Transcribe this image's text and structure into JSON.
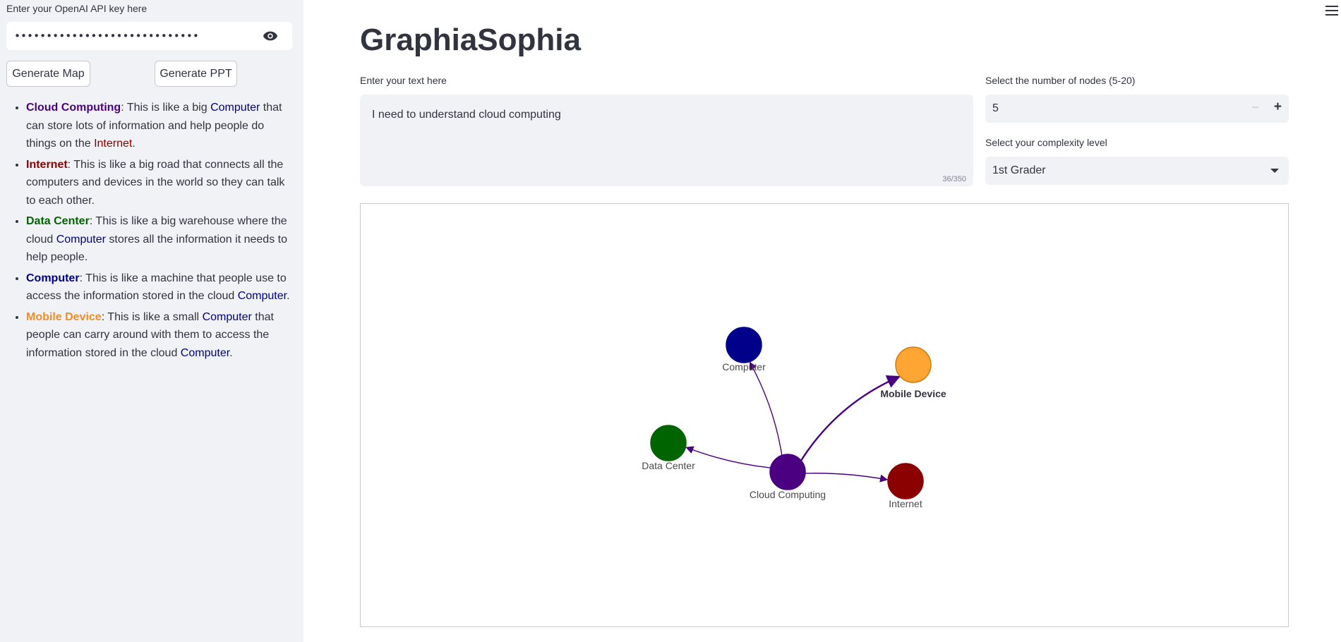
{
  "sidebar": {
    "api_label": "Enter your OpenAI API key here",
    "api_mask": "••••••••••••••••••••••••••••••••••••••••••••••••••••",
    "generate_map": "Generate Map",
    "generate_ppt": "Generate PPT",
    "definitions": [
      {
        "term": "Cloud Computing",
        "parts": [
          ": This is like a big ",
          "Computer",
          " that can store lots of information and help people do things on the ",
          "Internet",
          "."
        ]
      },
      {
        "term": "Internet",
        "text": ": This is like a big road that connects all the computers and devices in the world so they can talk to each other."
      },
      {
        "term": "Data Center",
        "parts": [
          ": This is like a big warehouse where the cloud ",
          "Computer",
          " stores all the information it needs to help people."
        ]
      },
      {
        "term": "Computer",
        "parts": [
          ": This is like a machine that people use to access the information stored in the cloud ",
          "Computer",
          "."
        ]
      },
      {
        "term": "Mobile Device",
        "parts": [
          ": This is like a small ",
          "Computer",
          " that people can carry around with them to access the information stored in the cloud ",
          "Computer",
          "."
        ]
      }
    ]
  },
  "main": {
    "title": "GraphiaSophia",
    "text_label": "Enter your text here",
    "text_value": "I need to understand cloud computing",
    "text_count": "36/350",
    "nodes_label": "Select the number of nodes (5-20)",
    "nodes_value": "5",
    "minus": "−",
    "plus": "+",
    "complexity_label": "Select your complexity level",
    "complexity_value": "1st Grader"
  },
  "graph": {
    "nodes": [
      {
        "id": "cc",
        "label": "Cloud Computing",
        "color": "#4b0082"
      },
      {
        "id": "comp",
        "label": "Computer",
        "color": "#00008b"
      },
      {
        "id": "mob",
        "label": "Mobile Device",
        "color": "#ffa533"
      },
      {
        "id": "dc",
        "label": "Data Center",
        "color": "#006400"
      },
      {
        "id": "inet",
        "label": "Internet",
        "color": "#8b0000"
      }
    ],
    "edges": [
      {
        "from": "Cloud Computing",
        "to": "Computer"
      },
      {
        "from": "Cloud Computing",
        "to": "Mobile Device"
      },
      {
        "from": "Cloud Computing",
        "to": "Data Center"
      },
      {
        "from": "Cloud Computing",
        "to": "Internet"
      }
    ],
    "edge_color": "#4b0082"
  },
  "icons": {
    "eye": "eye-icon",
    "menu": "hamburger-menu-icon",
    "chevron": "chevron-down-icon"
  }
}
